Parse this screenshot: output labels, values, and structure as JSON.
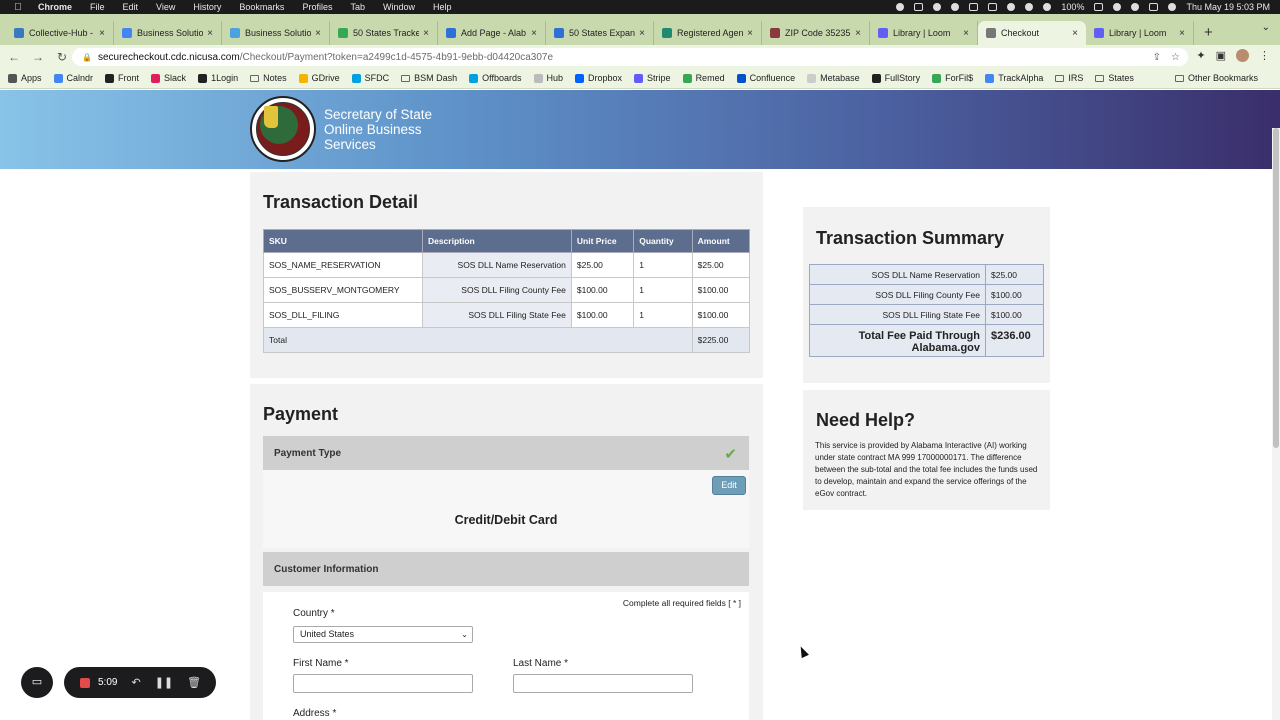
{
  "menubar": {
    "app": "Chrome",
    "items": [
      "File",
      "Edit",
      "View",
      "History",
      "Bookmarks",
      "Profiles",
      "Tab",
      "Window",
      "Help"
    ],
    "battery": "100%",
    "clock": "Thu May 19  5:03 PM"
  },
  "tabs": [
    {
      "label": "Collective-Hub -",
      "color": "#3a78c2"
    },
    {
      "label": "Business Solutio",
      "color": "#4285f4"
    },
    {
      "label": "Business Solutio",
      "color": "#4aa3df"
    },
    {
      "label": "50 States Tracke",
      "color": "#34a853"
    },
    {
      "label": "Add Page - Alab",
      "color": "#2e6fd8"
    },
    {
      "label": "50 States Expan",
      "color": "#2e6fd8"
    },
    {
      "label": "Registered Agen",
      "color": "#1f8a70"
    },
    {
      "label": "ZIP Code 35235",
      "color": "#8a3a3a"
    },
    {
      "label": "Library | Loom",
      "color": "#625df5"
    },
    {
      "label": "Checkout",
      "color": "#777777",
      "active": true
    },
    {
      "label": "Library | Loom",
      "color": "#625df5"
    }
  ],
  "address": {
    "host": "securecheckout.cdc.nicusa.com",
    "path": "/Checkout/Payment?token=a2499c1d-4575-4b91-9ebb-d04420ca307e"
  },
  "bookmarks": {
    "items": [
      {
        "label": "Apps",
        "color": "#555555"
      },
      {
        "label": "Calndr",
        "color": "#4285f4"
      },
      {
        "label": "Front",
        "color": "#222222"
      },
      {
        "label": "Slack",
        "color": "#e01e5a"
      },
      {
        "label": "1Login",
        "color": "#222222"
      },
      {
        "label": "Notes",
        "folder": true
      },
      {
        "label": "GDrive",
        "color": "#f4b400"
      },
      {
        "label": "SFDC",
        "color": "#00a1e0"
      },
      {
        "label": "BSM Dash",
        "folder": true
      },
      {
        "label": "Offboards",
        "color": "#00a1e0"
      },
      {
        "label": "Hub",
        "color": "#bbbbbb"
      },
      {
        "label": "Dropbox",
        "color": "#0061ff"
      },
      {
        "label": "Stripe",
        "color": "#635bff"
      },
      {
        "label": "Remed",
        "color": "#34a853"
      },
      {
        "label": "Confluence",
        "color": "#0052cc"
      },
      {
        "label": "Metabase",
        "color": "#cccccc"
      },
      {
        "label": "FullStory",
        "color": "#222222"
      },
      {
        "label": "ForFil$",
        "color": "#34a853"
      },
      {
        "label": "TrackAlpha",
        "color": "#4285f4"
      },
      {
        "label": "IRS",
        "folder": true
      },
      {
        "label": "States",
        "folder": true
      }
    ],
    "other": "Other Bookmarks"
  },
  "banner": {
    "title_line1": "Secretary of State",
    "title_line2": "Online Business",
    "title_line3": "Services"
  },
  "detail": {
    "title": "Transaction Detail",
    "headers": [
      "SKU",
      "Description",
      "Unit Price",
      "Quantity",
      "Amount"
    ],
    "rows": [
      [
        "SOS_NAME_RESERVATION",
        "SOS DLL Name Reservation",
        "$25.00",
        "1",
        "$25.00"
      ],
      [
        "SOS_BUSSERV_MONTGOMERY",
        "SOS DLL Filing County Fee",
        "$100.00",
        "1",
        "$100.00"
      ],
      [
        "SOS_DLL_FILING",
        "SOS DLL Filing State Fee",
        "$100.00",
        "1",
        "$100.00"
      ]
    ],
    "total_label": "Total",
    "total_value": "$225.00"
  },
  "summary": {
    "title": "Transaction Summary",
    "rows": [
      [
        "SOS DLL Name Reservation",
        "$25.00"
      ],
      [
        "SOS DLL Filing County Fee",
        "$100.00"
      ],
      [
        "SOS DLL Filing State Fee",
        "$100.00"
      ]
    ],
    "total_label": "Total Fee Paid Through Alabama.gov",
    "total_value": "$236.00"
  },
  "help": {
    "title": "Need Help?",
    "text": "This service is provided by Alabama Interactive (AI) working under state contract MA 999 17000000171. The difference between the sub-total and the total fee includes the funds used to develop, maintain and expand the service offerings of the eGov contract."
  },
  "payment": {
    "title": "Payment",
    "payment_type_label": "Payment Type",
    "edit_label": "Edit",
    "method": "Credit/Debit Card",
    "customer_info_label": "Customer Information",
    "required_note": "Complete all required fields [ * ]",
    "country_label": "Country *",
    "country_value": "United States",
    "first_name_label": "First Name *",
    "last_name_label": "Last Name *",
    "address_label": "Address *"
  },
  "recorder": {
    "time": "5:09"
  }
}
